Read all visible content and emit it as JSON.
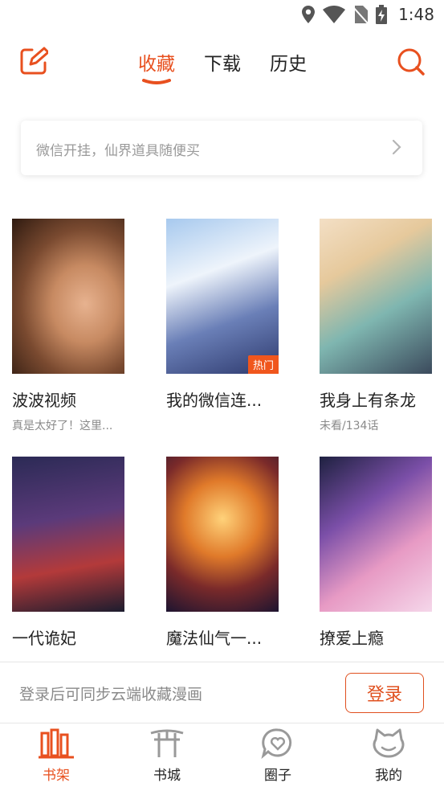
{
  "status_bar": {
    "time": "1:48"
  },
  "top_nav": {
    "tabs": [
      {
        "label": "收藏",
        "active": true
      },
      {
        "label": "下载",
        "active": false
      },
      {
        "label": "历史",
        "active": false
      }
    ]
  },
  "notice": {
    "text": "微信开挂，仙界道具随便买"
  },
  "comics": [
    {
      "title": "波波视频",
      "subtitle": "真是太好了！这里...",
      "badge": ""
    },
    {
      "title": "我的微信连...",
      "subtitle": "",
      "badge": "热门"
    },
    {
      "title": "我身上有条龙",
      "subtitle": "未看/134话",
      "badge": ""
    },
    {
      "title": "一代诡妃",
      "subtitle": "",
      "badge": ""
    },
    {
      "title": "魔法仙气一...",
      "subtitle": "",
      "badge": ""
    },
    {
      "title": "撩爱上瘾",
      "subtitle": "",
      "badge": ""
    }
  ],
  "login_bar": {
    "text": "登录后可同步云端收藏漫画",
    "button": "登录"
  },
  "bottom_nav": [
    {
      "label": "书架",
      "icon": "bookshelf-icon",
      "active": true
    },
    {
      "label": "书城",
      "icon": "bookstore-icon",
      "active": false
    },
    {
      "label": "圈子",
      "icon": "circle-heart-icon",
      "active": false
    },
    {
      "label": "我的",
      "icon": "cat-profile-icon",
      "active": false
    }
  ],
  "colors": {
    "accent": "#e8501f",
    "text": "#222222",
    "muted": "#8a8a8a"
  }
}
